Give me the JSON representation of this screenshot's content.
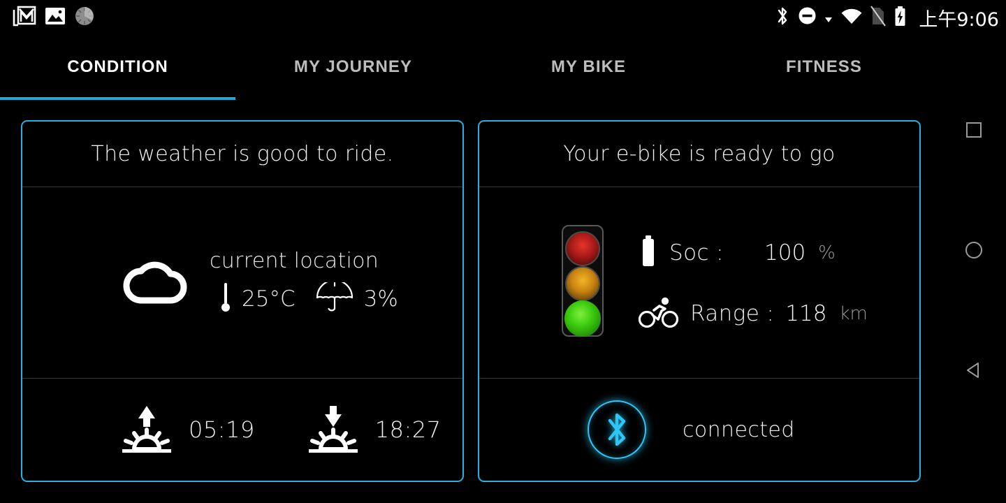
{
  "statusbar": {
    "left_icons": [
      {
        "name": "gmail-icon",
        "label": "Gmail"
      },
      {
        "name": "photo-icon",
        "label": "Photos"
      },
      {
        "name": "loading-spinner-icon",
        "label": "Loading"
      }
    ],
    "right_icons": [
      {
        "name": "bluetooth-icon",
        "label": "Bluetooth"
      },
      {
        "name": "do-not-disturb-icon",
        "label": "Do not disturb"
      },
      {
        "name": "wifi-icon",
        "label": "Wi-Fi"
      },
      {
        "name": "no-sim-icon",
        "label": "No SIM"
      },
      {
        "name": "battery-charging-icon",
        "label": "Battery charging"
      }
    ],
    "clock": "上午9:06"
  },
  "tabs": [
    {
      "label": "CONDITION",
      "active": true
    },
    {
      "label": "MY JOURNEY",
      "active": false
    },
    {
      "label": "MY BIKE",
      "active": false
    },
    {
      "label": "FITNESS",
      "active": false
    }
  ],
  "weather_card": {
    "title": "The weather is good to ride.",
    "location": "current location",
    "temperature": "25°C",
    "precipitation": "3%",
    "sunrise": "05:19",
    "sunset": "18:27",
    "icons": {
      "weather": "cloud-icon",
      "temperature": "thermometer-icon",
      "precipitation": "umbrella-icon",
      "sunrise": "sunrise-icon",
      "sunset": "sunset-icon"
    }
  },
  "bike_card": {
    "title": "Your e-bike is ready to go",
    "traffic_light": {
      "red_on": false,
      "yellow_on": false,
      "green_on": true
    },
    "soc_label": "Soc :",
    "soc_value": "100",
    "soc_unit": "%",
    "range_label": "Range :",
    "range_value": "118",
    "range_unit": "km",
    "bluetooth_status": "connected",
    "icons": {
      "soc": "battery-icon",
      "range": "cyclist-icon",
      "bluetooth": "bluetooth-icon"
    }
  },
  "navbar": [
    {
      "name": "recents-button",
      "label": "Recents"
    },
    {
      "name": "home-button",
      "label": "Home"
    },
    {
      "name": "back-button",
      "label": "Back"
    }
  ],
  "colors": {
    "accent_cyan": "#29b0e0",
    "tab_underline": "#18a9d4",
    "bluetooth_glow": "#2ec6f5",
    "divider": "#1b3f4c",
    "background": "#000000",
    "inactive_tab_text": "#bdbdbd",
    "unit_text": "#9a9a9a"
  }
}
